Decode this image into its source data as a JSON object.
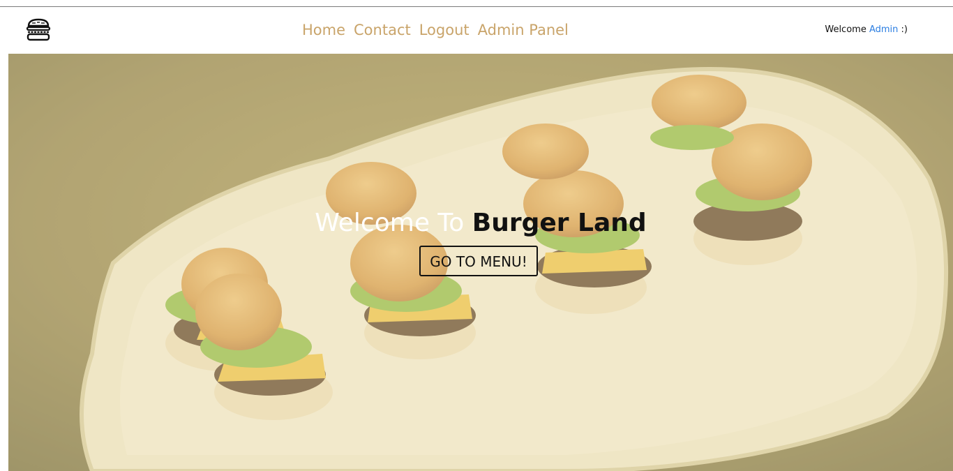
{
  "brand": {
    "logo_icon": "burger-logo-icon",
    "accent_color": "#c9a46a"
  },
  "nav": {
    "links": [
      {
        "label": "Home"
      },
      {
        "label": "Contact"
      },
      {
        "label": "Logout"
      },
      {
        "label": "Admin Panel"
      }
    ]
  },
  "user": {
    "welcome_prefix": "Welcome",
    "name": "Admin",
    "welcome_suffix": ":)",
    "name_color": "#2a7de1"
  },
  "hero": {
    "title_prefix": "Welcome To",
    "title_brand": "Burger Land",
    "cta_label": "GO TO MENU!",
    "overlay_color": "#e9dcaa"
  }
}
